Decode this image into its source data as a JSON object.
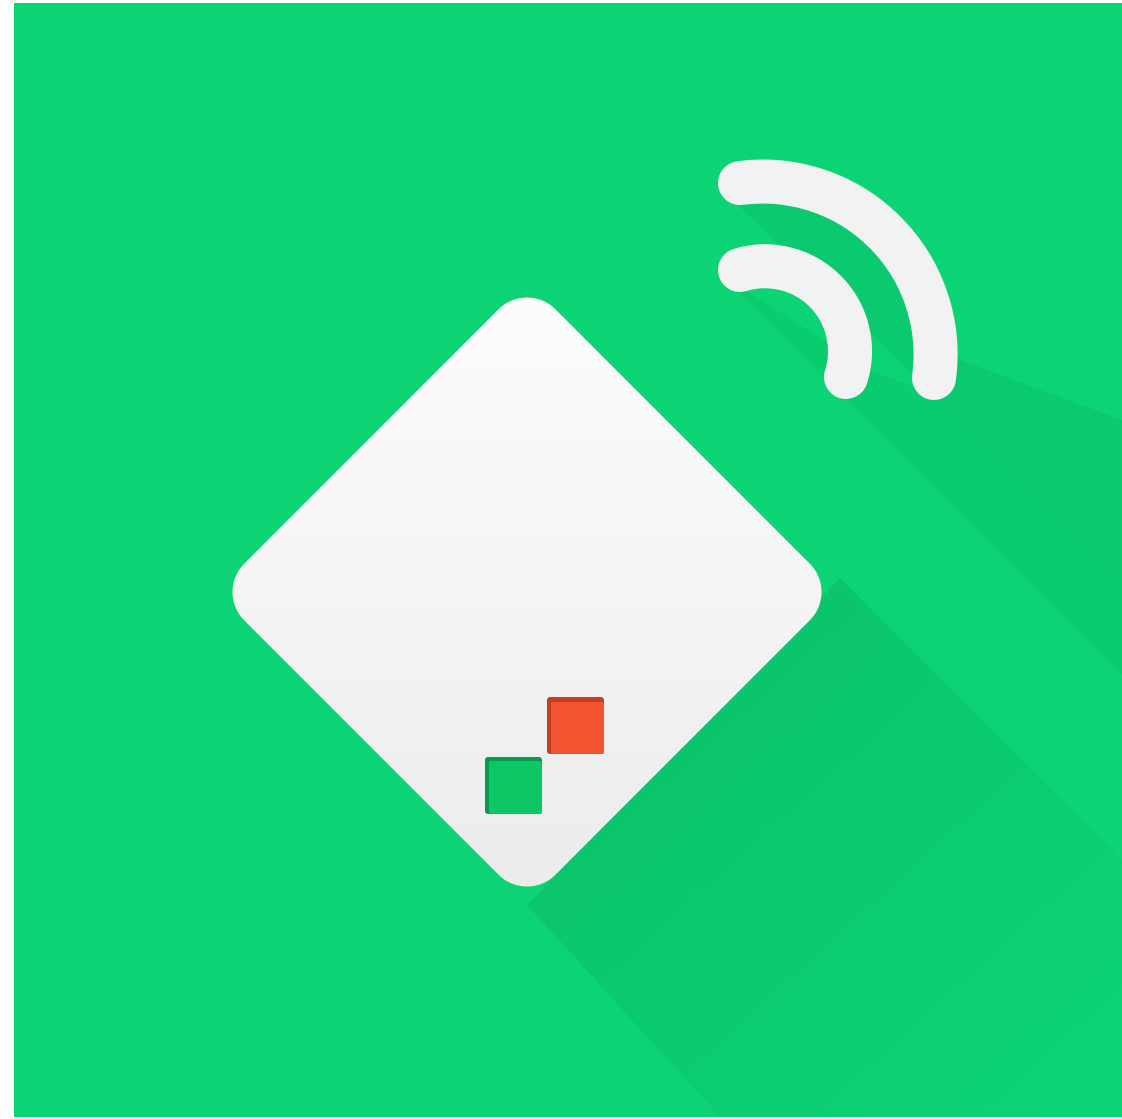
{
  "app_icon": {
    "name": "nfc-tag-icon",
    "colors": {
      "background": "#0cd474",
      "long_shadow": "#09bd63",
      "card_light": "#fbfbfb",
      "card_dark": "#ececec",
      "red_chip": "#f4532f",
      "red_chip_edge": "#c73f1f",
      "green_chip": "#0dc767",
      "green_chip_edge": "#089a4d",
      "signal_arcs": "#f2f2f2"
    },
    "elements": {
      "card": "tag-card",
      "chips": [
        "red-chip",
        "green-chip"
      ],
      "signal": [
        "signal-arc-inner",
        "signal-arc-outer"
      ]
    }
  }
}
